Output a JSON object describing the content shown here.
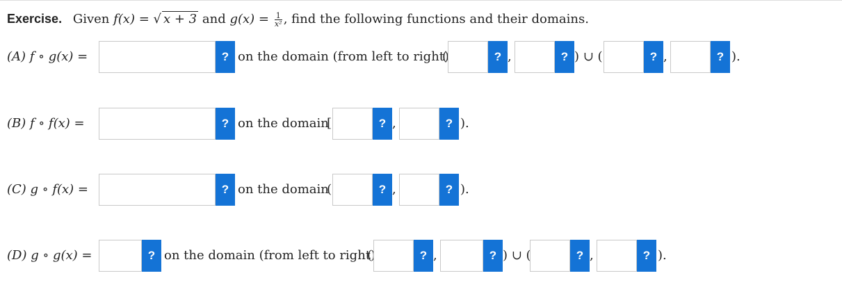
{
  "statement": {
    "exercise_label": "Exercise.",
    "given": "Given",
    "f_def_lhs": "f(x) =",
    "f_def_rad": "x + 3",
    "and": "and",
    "g_def_lhs": "g(x) =",
    "g_num": "1",
    "g_den": "x²",
    "rest": ", find the following functions and their domains."
  },
  "help_glyph": "?",
  "parts": [
    {
      "label": "(A) f ∘ g(x) =",
      "domain_text": "on the domain (from left to right)",
      "open": "(",
      "comma": ",",
      "union": ") ∪ (",
      "close": ")."
    },
    {
      "label": "(B) f ∘ f(x) =",
      "domain_text": "on the domain",
      "open": "[",
      "comma": ",",
      "close": ")."
    },
    {
      "label": "(C) g ∘ f(x) =",
      "domain_text": "on the domain",
      "open": "(",
      "comma": ",",
      "close": ")."
    },
    {
      "label": "(D) g ∘ g(x) =",
      "domain_text": "on the domain (from left to right)",
      "open": "(",
      "comma": ",",
      "union": ") ∪ (",
      "close": ")."
    }
  ]
}
